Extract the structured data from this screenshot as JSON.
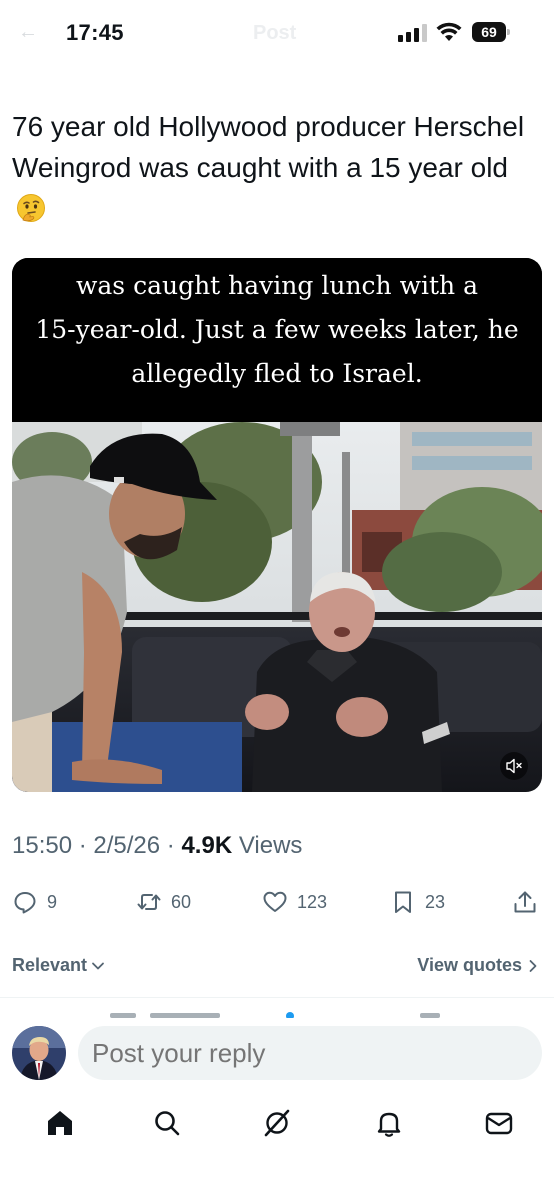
{
  "status_bar": {
    "time": "17:45",
    "battery_level": "69",
    "icons": [
      "signal-icon",
      "wifi-icon",
      "battery-icon"
    ]
  },
  "header": {
    "back_icon": "back-arrow-icon",
    "title": "Post"
  },
  "post": {
    "text": "76 year old Hollywood producer Herschel Weingrod was caught with a 15 year old",
    "emoji": "thinking-face-emoji",
    "media": {
      "caption_lines": [
        "was caught having lunch with a",
        "15-year-old. Just a few weeks later, he",
        "allegedly fled to Israel."
      ],
      "mute_icon": "muted-speaker-icon"
    },
    "meta": {
      "time": "15:50",
      "separator": " · ",
      "date": "2/5/26",
      "views_count": "4.9K",
      "views_label": "Views"
    },
    "actions": {
      "replies": "9",
      "reposts": "60",
      "likes": "123",
      "bookmarks": "23"
    }
  },
  "replies_header": {
    "sort_label": "Relevant",
    "view_quotes_label": "View quotes"
  },
  "reply_composer": {
    "placeholder": "Post your reply"
  },
  "tab_bar": {
    "items": [
      "home-icon",
      "search-icon",
      "grok-icon",
      "notifications-icon",
      "messages-icon"
    ]
  },
  "colors": {
    "text_primary": "#0f1419",
    "text_secondary": "#536471",
    "input_bg": "#eff3f4",
    "divider": "#eff3f4"
  }
}
